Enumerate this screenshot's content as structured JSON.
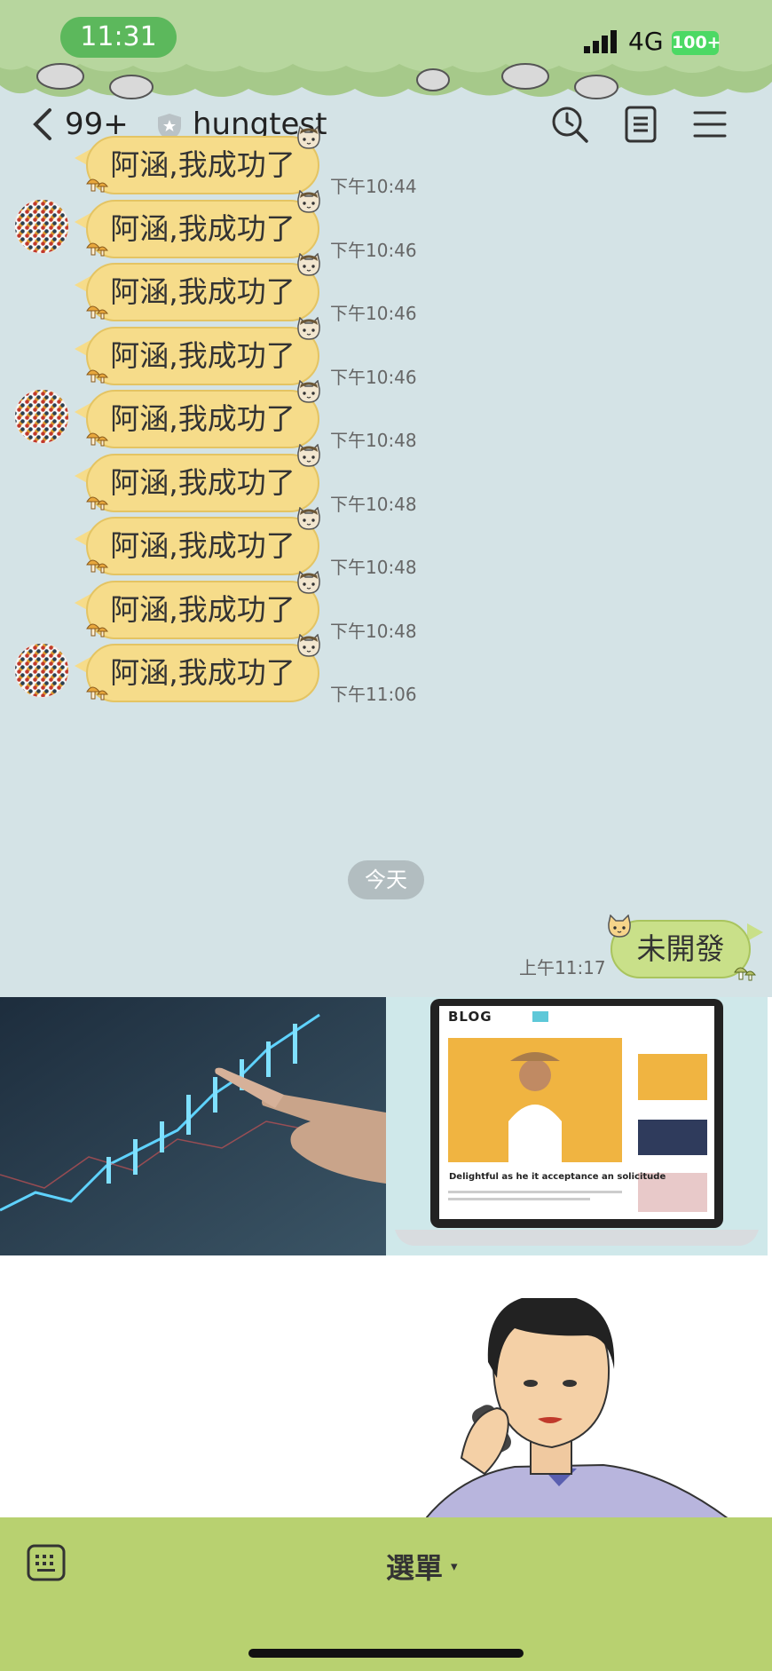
{
  "status_bar": {
    "time": "11:31",
    "network": "4G",
    "battery": "100+"
  },
  "header": {
    "unread_count": "99+",
    "chat_title": "hungtest"
  },
  "incoming_messages": [
    {
      "text": "阿涵,我成功了",
      "time": "下午10:44",
      "show_avatar": false
    },
    {
      "text": "阿涵,我成功了",
      "time": "下午10:46",
      "show_avatar": true
    },
    {
      "text": "阿涵,我成功了",
      "time": "下午10:46",
      "show_avatar": false
    },
    {
      "text": "阿涵,我成功了",
      "time": "下午10:46",
      "show_avatar": false
    },
    {
      "text": "阿涵,我成功了",
      "time": "下午10:48",
      "show_avatar": true
    },
    {
      "text": "阿涵,我成功了",
      "time": "下午10:48",
      "show_avatar": false
    },
    {
      "text": "阿涵,我成功了",
      "time": "下午10:48",
      "show_avatar": false
    },
    {
      "text": "阿涵,我成功了",
      "time": "下午10:48",
      "show_avatar": false
    },
    {
      "text": "阿涵,我成功了",
      "time": "下午11:06",
      "show_avatar": true
    }
  ],
  "date_separator": "今天",
  "outgoing_message": {
    "text": "未開發",
    "time": "上午11:17"
  },
  "rich_menu": {
    "tiles": [
      "stock-chart-image",
      "blog-laptop-image",
      "phone-call-illustration"
    ],
    "blog_title": "BLOG",
    "blog_caption": "Delightful as he it acceptance an solicitude"
  },
  "bottom_bar": {
    "menu_label": "選單",
    "menu_caret": "▾"
  },
  "colors": {
    "background": "#d4e3e6",
    "incoming_bubble": "#f6dc8a",
    "outgoing_bubble": "#c9e089",
    "bottom_bar": "#b8d170",
    "time_pill": "#5cb85c",
    "battery": "#4cd964"
  }
}
